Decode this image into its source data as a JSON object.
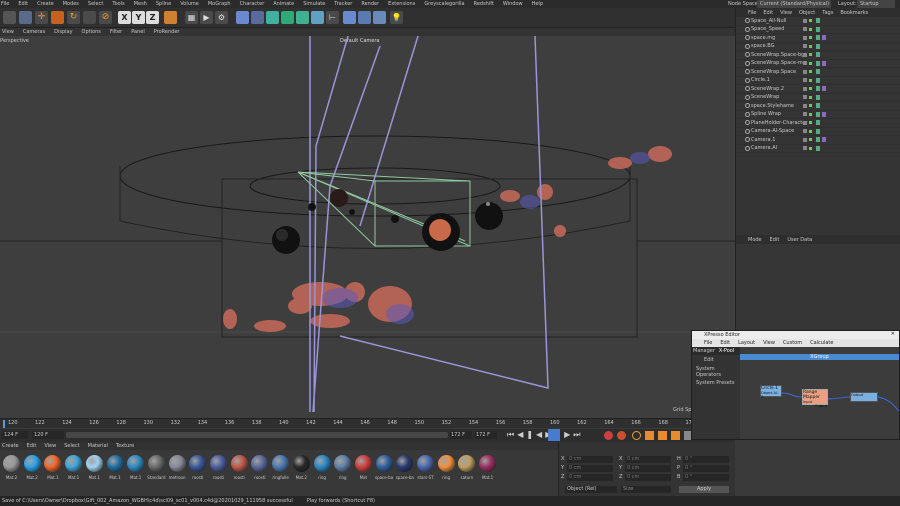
{
  "menubar": {
    "items": [
      "File",
      "Edit",
      "Create",
      "Modes",
      "Select",
      "Tools",
      "Mesh",
      "Spline",
      "Volume",
      "MoGraph",
      "Character",
      "Animate",
      "Simulate",
      "Tracker",
      "Render",
      "Extensions",
      "Greyscalegorilla",
      "Redshift",
      "Window",
      "Help"
    ],
    "node_space_label": "Node Space:",
    "node_space_value": "Current (Standard/Physical)",
    "layout_label": "Layout:",
    "layout_value": "Startup"
  },
  "viewport": {
    "menu": [
      "View",
      "Cameras",
      "Display",
      "Options",
      "Filter",
      "Panel",
      "ProRender"
    ],
    "view_name": "Perspective",
    "camera": "Default Camera",
    "grid_label": "Grid Spa"
  },
  "timeline": {
    "ticks": [
      "120",
      "122",
      "124",
      "126",
      "128",
      "130",
      "132",
      "134",
      "136",
      "138",
      "140",
      "142",
      "144",
      "146",
      "148",
      "150",
      "152",
      "154",
      "156",
      "158",
      "160",
      "162",
      "164",
      "166",
      "168",
      "170",
      "172"
    ],
    "current_frame": "124 F",
    "start_frame": "120 F",
    "end_frame": "172 F",
    "end_frame_2": "172 F"
  },
  "object_manager": {
    "menu": [
      "File",
      "Edit",
      "View",
      "Object",
      "Tags",
      "Bookmarks"
    ],
    "objects": [
      "Space_All-Null",
      "Space_Speed",
      "space.mg",
      "space.BG",
      "SceneWrap.Space-bg",
      "SceneWrap.Space-mg",
      "SceneWrap.Space",
      "Circle.1",
      "SceneWrap.2",
      "SceneWrap",
      "space.Stylehame",
      "Spline Wrap",
      "PlaneHolder-Character",
      "Camera-Al-Space",
      "Camera.1",
      "Camera.Al"
    ]
  },
  "attribute_manager": {
    "menu": [
      "Mode",
      "Edit",
      "User Data"
    ]
  },
  "xpresso": {
    "title": "XPresso Editor",
    "menu": [
      "File",
      "Edit",
      "Layout",
      "View",
      "Custom",
      "Calculate"
    ],
    "tabs": [
      "Manager",
      "X-Pool"
    ],
    "edit_label": "Edit",
    "tree": [
      "System Operators",
      "System Presets"
    ],
    "group_label": "XGroup",
    "node_circle": "Circle.1",
    "node_circle_port": "Object  Al. 8",
    "node_range": "Range Mapper",
    "node_range_port": "Output",
    "node_range_in": "Input",
    "node_bottom": "Output"
  },
  "materials": {
    "menu": [
      "Create",
      "Edit",
      "View",
      "Select",
      "Material",
      "Texture"
    ],
    "items": [
      {
        "label": "Mat.2",
        "color": "#9a9a9a"
      },
      {
        "label": "Mat.2",
        "color": "#2aa3e8"
      },
      {
        "label": "Mat.1",
        "color": "#f0682a"
      },
      {
        "label": "Mat.1",
        "color": "#3fa6d8"
      },
      {
        "label": "Mat.1",
        "color": "#9fd3f0"
      },
      {
        "label": "Mat.1",
        "color": "#1f6ea0"
      },
      {
        "label": "Mat.1",
        "color": "#2d8bc1"
      },
      {
        "label": "Standard",
        "color": "#6a6a6a"
      },
      {
        "label": "metroon",
        "color": "#888898"
      },
      {
        "label": "roosti",
        "color": "#3a5a9a"
      },
      {
        "label": "roosti",
        "color": "#4a5fa0"
      },
      {
        "label": "roosti",
        "color": "#c05a4a"
      },
      {
        "label": "roosti",
        "color": "#5a6a9a"
      },
      {
        "label": "ringfulle",
        "color": "#4a7ab0"
      },
      {
        "label": "Mat.2",
        "color": "#2a2a2a"
      },
      {
        "label": "ring",
        "color": "#2a8ac8"
      },
      {
        "label": "ring",
        "color": "#6080a8"
      },
      {
        "label": "Mat",
        "color": "#d04040"
      },
      {
        "label": "space-ba",
        "color": "#3060a0"
      },
      {
        "label": "space-ba",
        "color": "#2a3a70"
      },
      {
        "label": "stars-ST",
        "color": "#4a6ab0"
      },
      {
        "label": "ring",
        "color": "#f09040"
      },
      {
        "label": "saturn",
        "color": "#c0a060"
      },
      {
        "label": "Mat.1",
        "color": "#9a3060"
      }
    ]
  },
  "coordinates": {
    "rows": [
      [
        "X",
        "0 cm",
        "X",
        "0 cm",
        "H",
        "0 °"
      ],
      [
        "Y",
        "0 cm",
        "Y",
        "0 cm",
        "P",
        "0 °"
      ],
      [
        "Z",
        "0 cm",
        "Z",
        "0 cm",
        "B",
        "0 °"
      ]
    ],
    "mode": "Object (Rel)",
    "size_mode": "Size",
    "apply_label": "Apply"
  },
  "status": {
    "text": "Save of C:\\Users\\Owner\\Dropbox\\Gift_002_Amazon_WGBH\\c4d\\sci09_sc01_v004.c4d@20201029_111958 successful",
    "play_hint": "Play forwards (Shortcut F8)"
  }
}
